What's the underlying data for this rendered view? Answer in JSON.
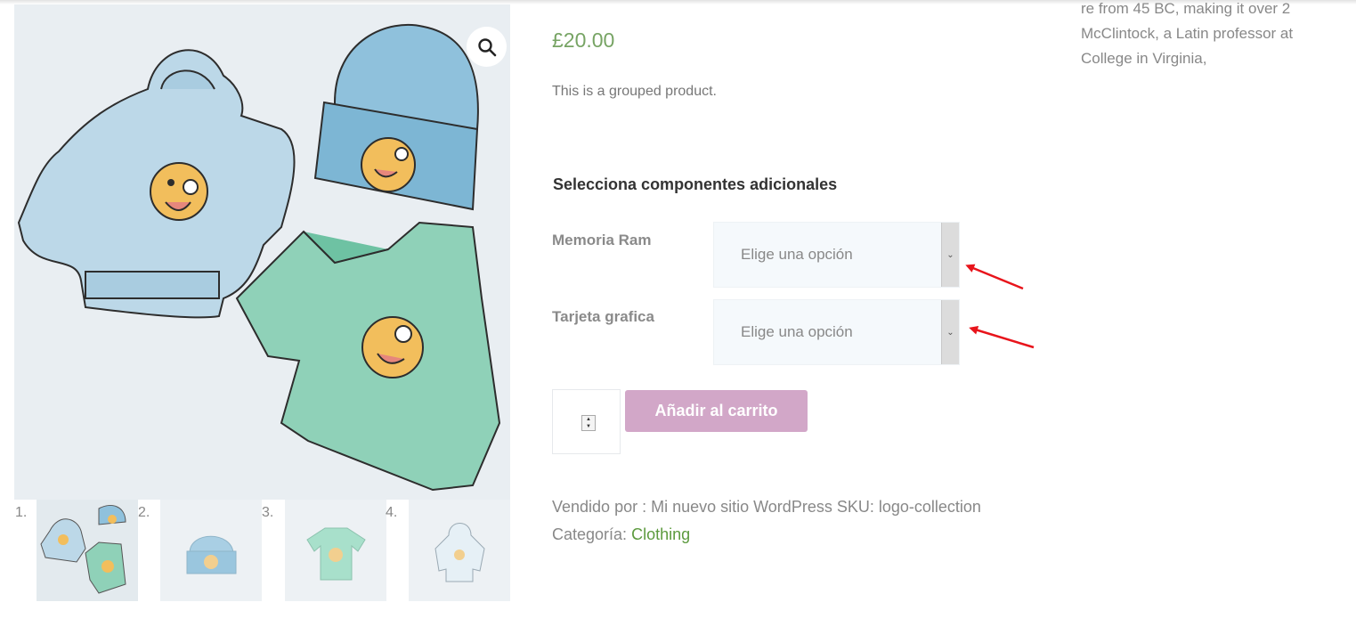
{
  "product": {
    "price": "£20.00",
    "short_description": "This is a grouped product.",
    "components_title": "Selecciona componentes adicionales",
    "attributes": [
      {
        "label": "Memoria Ram",
        "selected": "Elige una opción"
      },
      {
        "label": "Tarjeta grafica",
        "selected": "Elige una opción"
      }
    ],
    "add_to_cart_label": "Añadir al carrito",
    "meta": {
      "sold_by_text": "Vendido por : Mi nuevo sitio WordPress",
      "sku_text": "SKU: logo-collection",
      "category_label": "Categoría:",
      "category_link": "Clothing"
    }
  },
  "gallery": {
    "thumbnails": [
      {
        "number": "1."
      },
      {
        "number": "2."
      },
      {
        "number": "3."
      },
      {
        "number": "4."
      }
    ]
  },
  "sidebar": {
    "lines": [
      "re from 45 BC, making it over 2",
      "McClintock, a Latin professor at",
      "College in Virginia,"
    ]
  },
  "colors": {
    "price": "#77a464",
    "button": "#d2a7c8",
    "link": "#5c9a3e",
    "annotation_arrow": "#e8141b"
  },
  "icons": {
    "zoom": "magnifier-icon",
    "select_arrow": "chevron-down-icon"
  }
}
